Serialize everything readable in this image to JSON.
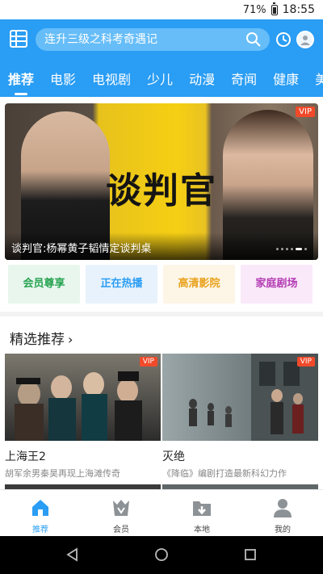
{
  "status": {
    "battery": "71%",
    "time": "18:55"
  },
  "header": {
    "search_text": "连升三级之科考奇遇记",
    "tabs": [
      {
        "label": "推荐",
        "active": true
      },
      {
        "label": "电影"
      },
      {
        "label": "电视剧"
      },
      {
        "label": "少儿"
      },
      {
        "label": "动漫"
      },
      {
        "label": "奇闻"
      },
      {
        "label": "健康"
      },
      {
        "label": "美"
      }
    ]
  },
  "banner": {
    "title": "谈判官",
    "vip": "VIP",
    "caption": "谈判官:杨幂黄子韬情定谈判桌"
  },
  "quick_links": [
    {
      "label": "会员尊享",
      "color": "#27a350",
      "bg": "#e8f6ee"
    },
    {
      "label": "正在热播",
      "color": "#2a9df4",
      "bg": "#e8f2fc"
    },
    {
      "label": "高清影院",
      "color": "#e9a21b",
      "bg": "#fdf5e6"
    },
    {
      "label": "家庭剧场",
      "color": "#b33bb3",
      "bg": "#f9e9f9"
    }
  ],
  "section": {
    "title": "精选推荐"
  },
  "cards": [
    {
      "name": "上海王2",
      "desc": "胡军余男秦昊再现上海滩传奇",
      "vip": "VIP"
    },
    {
      "name": "灭绝",
      "desc": "《降临》编剧打造最新科幻力作",
      "vip": "VIP"
    }
  ],
  "tabbar": [
    {
      "label": "推荐",
      "icon": "home-icon",
      "active": true
    },
    {
      "label": "会员",
      "icon": "crown-icon"
    },
    {
      "label": "本地",
      "icon": "download-folder-icon"
    },
    {
      "label": "我的",
      "icon": "person-icon"
    }
  ],
  "colors": {
    "accent": "#2a9df4",
    "vip": "#f04a2a"
  }
}
